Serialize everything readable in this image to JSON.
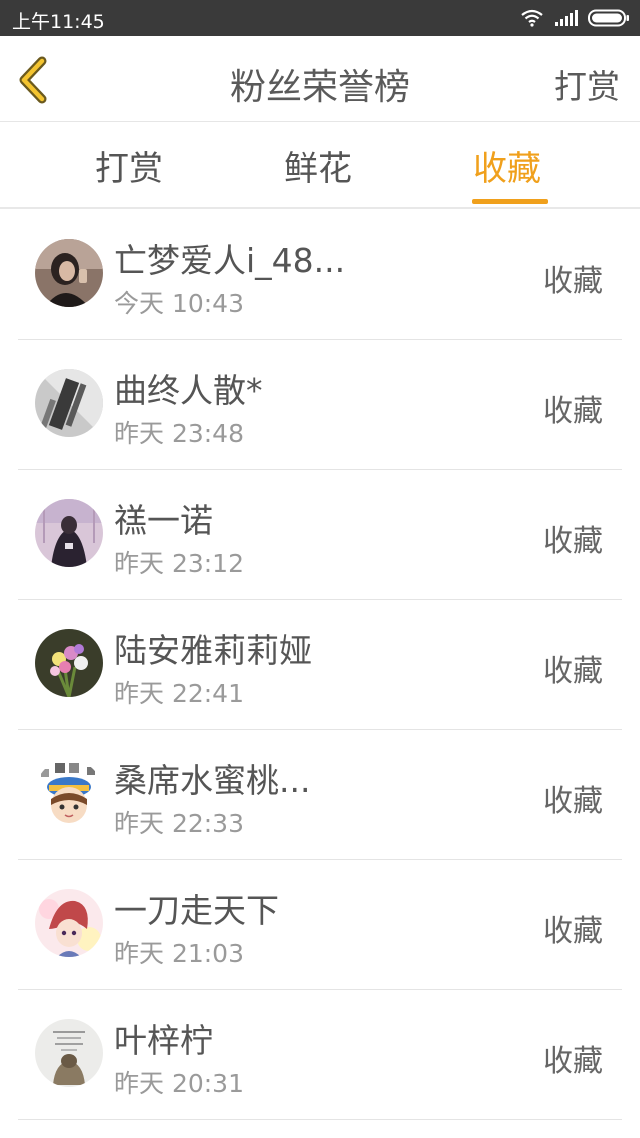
{
  "status_bar": {
    "time": "上午11:45"
  },
  "nav": {
    "title": "粉丝荣誉榜",
    "action_label": "打赏"
  },
  "tabs": [
    {
      "label": "打赏"
    },
    {
      "label": "鲜花"
    },
    {
      "label": "收藏"
    }
  ],
  "active_tab": "收藏",
  "colors": {
    "accent": "#f0a01c",
    "text": "#555555",
    "subtext": "#9a9a9a"
  },
  "fans": [
    {
      "name": "亡梦爱人i_48...",
      "time": "今天 10:43",
      "badge": "收藏"
    },
    {
      "name": "曲终人散*",
      "time": "昨天 23:48",
      "badge": "收藏"
    },
    {
      "name": "禚一诺",
      "time": "昨天 23:12",
      "badge": "收藏"
    },
    {
      "name": "陆安雅莉莉娅",
      "time": "昨天 22:41",
      "badge": "收藏"
    },
    {
      "name": "桑席水蜜桃...",
      "time": "昨天 22:33",
      "badge": "收藏"
    },
    {
      "name": "一刀走天下",
      "time": "昨天 21:03",
      "badge": "收藏"
    },
    {
      "name": "叶梓柠",
      "time": "昨天 20:31",
      "badge": "收藏"
    }
  ]
}
